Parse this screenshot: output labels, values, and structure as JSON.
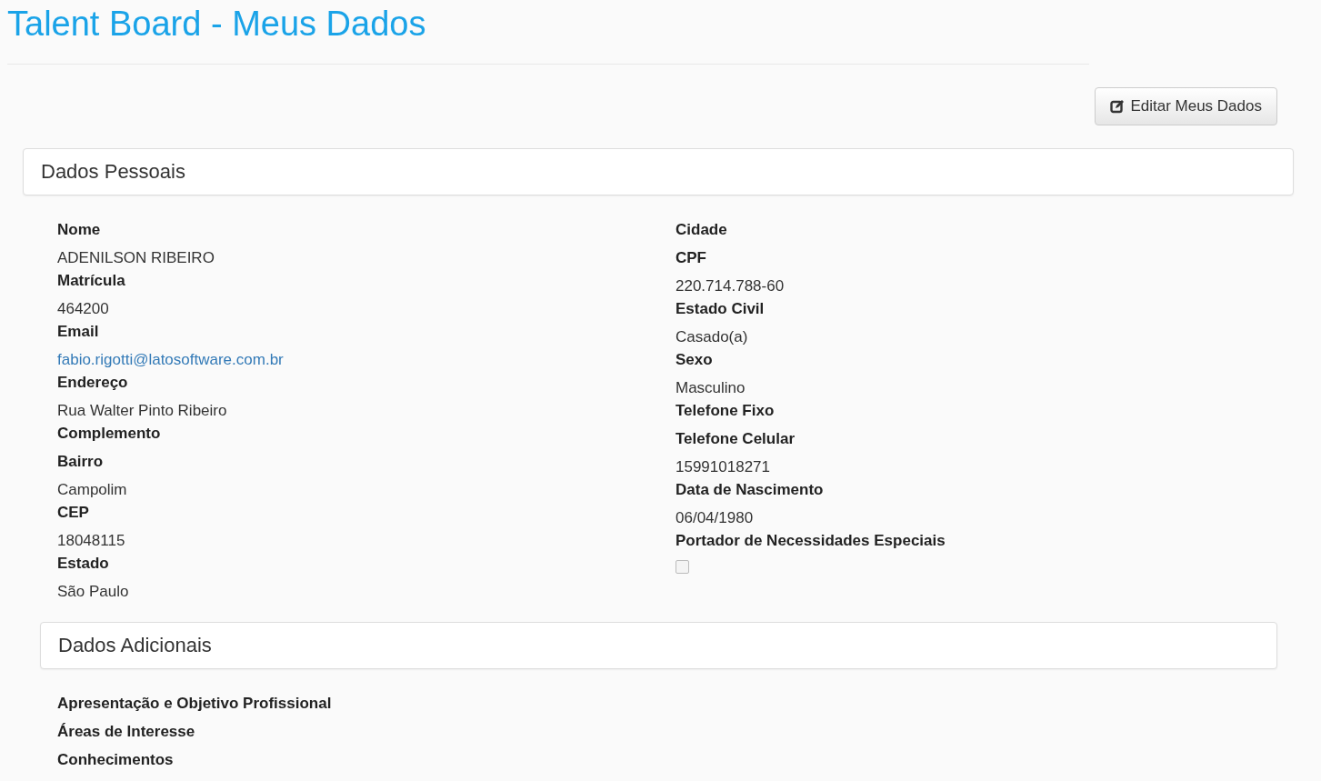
{
  "page_title": "Talent Board - Meus Dados",
  "edit_button": {
    "label": "Editar Meus Dados"
  },
  "personal": {
    "title": "Dados Pessoais",
    "left": [
      {
        "kind": "text",
        "label": "Nome",
        "value": "ADENILSON RIBEIRO"
      },
      {
        "kind": "text",
        "label": "Matrícula",
        "value": "464200"
      },
      {
        "kind": "link",
        "label": "Email",
        "value": "fabio.rigotti@latosoftware.com.br"
      },
      {
        "kind": "text",
        "label": "Endereço",
        "value": "Rua Walter Pinto Ribeiro"
      },
      {
        "kind": "text",
        "label": "Complemento"
      },
      {
        "kind": "text",
        "label": "Bairro",
        "value": "Campolim"
      },
      {
        "kind": "text",
        "label": "CEP",
        "value": "18048115"
      },
      {
        "kind": "text",
        "label": "Estado",
        "value": "São Paulo"
      }
    ],
    "right": [
      {
        "kind": "text",
        "label": "Cidade"
      },
      {
        "kind": "text",
        "label": "CPF",
        "value": "220.714.788-60"
      },
      {
        "kind": "text",
        "label": "Estado Civil",
        "value": "Casado(a)"
      },
      {
        "kind": "text",
        "label": "Sexo",
        "value": "Masculino"
      },
      {
        "kind": "text",
        "label": "Telefone Fixo"
      },
      {
        "kind": "text",
        "label": "Telefone Celular",
        "value": "15991018271"
      },
      {
        "kind": "text",
        "label": "Data de Nascimento",
        "value": "06/04/1980"
      },
      {
        "kind": "checkbox",
        "label": "Portador de Necessidades Especiais",
        "checked": false
      }
    ]
  },
  "additional": {
    "title": "Dados Adicionais",
    "fields": [
      {
        "kind": "text",
        "label": "Apresentação e Objetivo Profissional"
      },
      {
        "kind": "text",
        "label": "Áreas de Interesse"
      },
      {
        "kind": "text",
        "label": "Conhecimentos"
      }
    ]
  }
}
